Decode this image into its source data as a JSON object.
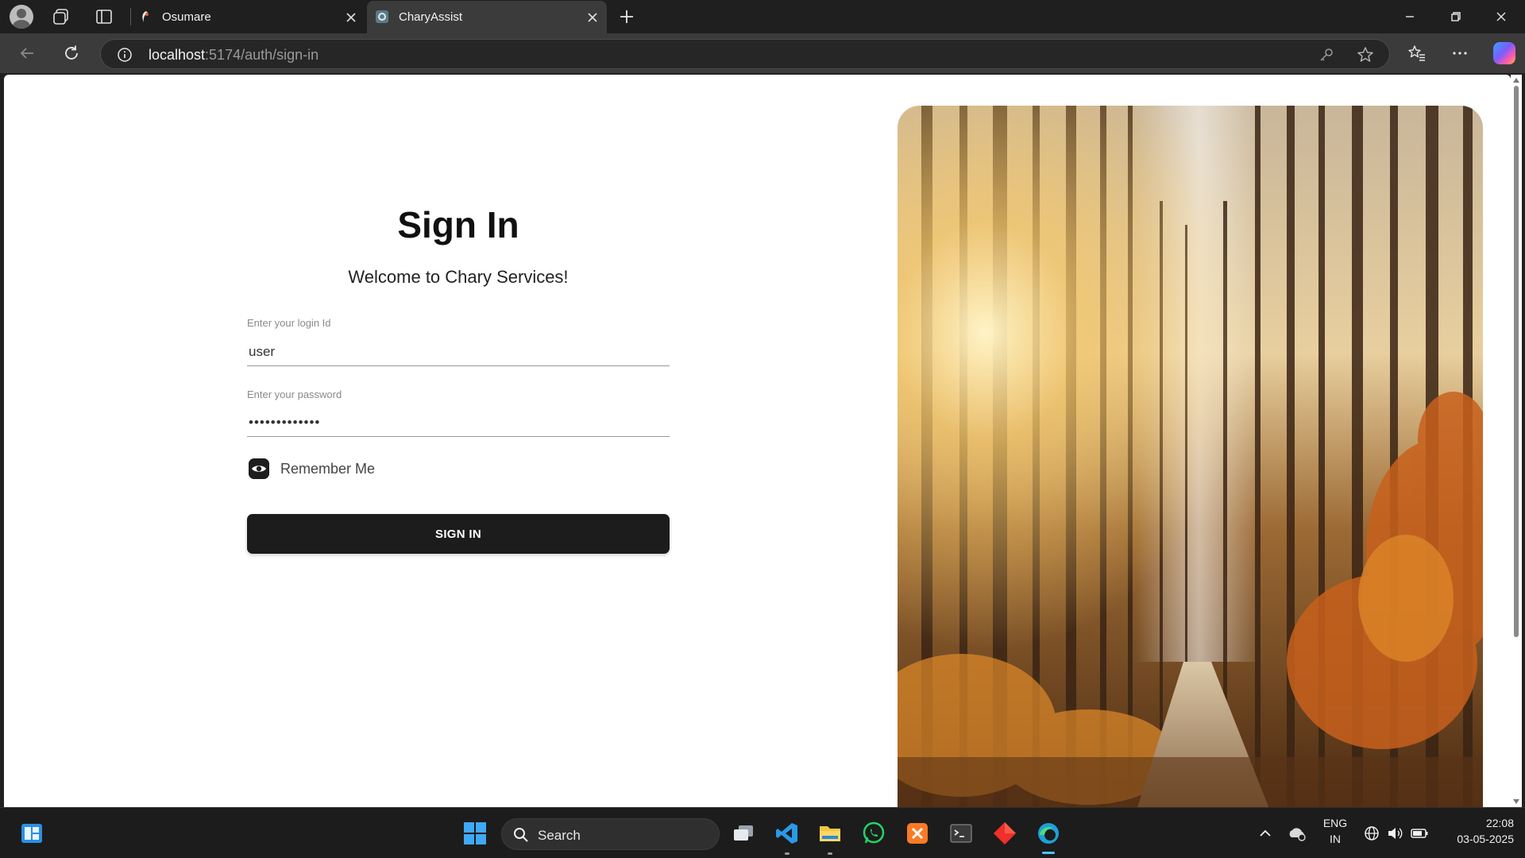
{
  "browser": {
    "tabs": [
      {
        "title": "Osumare",
        "active": false
      },
      {
        "title": "CharyAssist",
        "active": true
      }
    ],
    "address_host": "localhost",
    "address_path": ":5174/auth/sign-in"
  },
  "signin": {
    "heading": "Sign In",
    "welcome": "Welcome to Chary Services!",
    "login_label": "Enter your login Id",
    "login_value": "user",
    "password_label": "Enter your password",
    "password_value": "•••••••••••••",
    "remember_label": "Remember Me",
    "button_label": "SIGN IN"
  },
  "taskbar": {
    "search_label": "Search",
    "language": "ENG",
    "region": "IN",
    "time": "22:08",
    "date": "03-05-2025"
  },
  "colors": {
    "accent": "#4cc2ff",
    "button": "#1c1c1c"
  }
}
